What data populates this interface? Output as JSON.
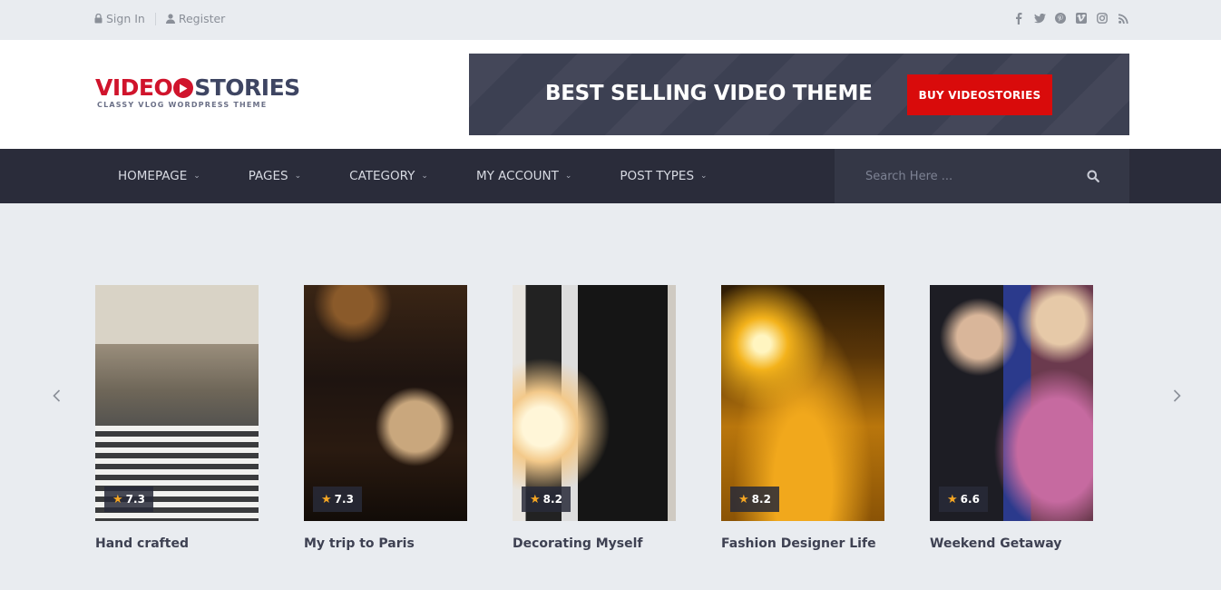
{
  "topbar": {
    "sign_in": "Sign In",
    "register": "Register",
    "social_icons": [
      "facebook-icon",
      "twitter-icon",
      "pinterest-icon",
      "vimeo-icon",
      "instagram-icon",
      "rss-icon"
    ]
  },
  "logo": {
    "video": "VIDEO",
    "stories": "STORIES",
    "tagline": "CLASSY VLOG WORDPRESS THEME"
  },
  "banner": {
    "headline": "BEST SELLING VIDEO THEME",
    "button": "BUY VIDEOSTORIES"
  },
  "nav": {
    "items": [
      "HOMEPAGE",
      "PAGES",
      "CATEGORY",
      "MY ACCOUNT",
      "POST TYPES"
    ],
    "search_placeholder": "Search Here ..."
  },
  "carousel": {
    "cards": [
      {
        "title": "Hand crafted",
        "rating": "7.3"
      },
      {
        "title": "My trip to Paris",
        "rating": "7.3"
      },
      {
        "title": "Decorating Myself",
        "rating": "8.2"
      },
      {
        "title": "Fashion Designer Life",
        "rating": "8.2"
      },
      {
        "title": "Weekend Getaway",
        "rating": "6.6"
      }
    ]
  },
  "colors": {
    "brand_red": "#d0142c",
    "brand_navy": "#3e4562",
    "nav_bg": "#2a2c3a",
    "button_red": "#d90b0b",
    "star": "#f5a623"
  }
}
